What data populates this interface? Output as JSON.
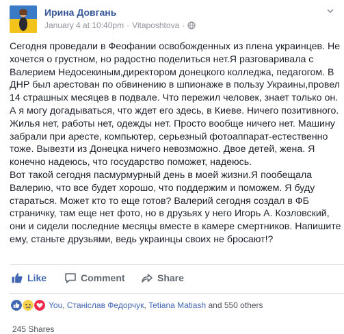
{
  "post": {
    "author": "Ирина Довгань",
    "timestamp": "January 4 at 10:40pm",
    "separator": "·",
    "location": "Vitaposhtova",
    "icons": {
      "privacy": "globe-icon",
      "menu": "chevron-down-icon"
    },
    "body": [
      "Сегодня проведали в Феофании освобожденных из плена украинцев. Не хочется о грустном, но радостно поделиться нет.Я разговаривала с Валерием Недосекиным,директором донецкого колледжа, педагогом. В ДНР был арестован по обвинению в шпионаже в пользу Украины,провел 14 страшных месяцев в подвале. Что пережил человек, знает только он. А я могу догадываться, что ждет его здесь, в Киеве. Ничего позитивного. Жилья нет, работы нет, одежды нет. Просто вообще ничего нет. Машину забрали при аресте, компьютер, серьезный фотоаппарат-естественно тоже. Вывезти из Донецка ничего невозможно. Двое детей, жена. Я конечно надеюсь, что государство поможет, надеюсь.",
      "Вот такой сегодня пасмурмурный день в моей жизни.Я пообещала Валерию, что все будет хорошо, что поддержим и поможем. Я буду стараться. Может кто то еще готов? Валерий сегодня создал в ФБ страничку, там еще нет фото, но в друзьях у него Игорь А. Козловский, они и сидели последние месяцы вместе в камере смертников. Напишите ему, станьте друзьями, ведь украинцы своих не бросают!?"
    ]
  },
  "actions": {
    "like": "Like",
    "comment": "Comment",
    "share": "Share"
  },
  "reactions": {
    "types": [
      "like-reaction-icon",
      "sad-reaction-icon",
      "love-reaction-icon"
    ],
    "you": "You",
    "sep1": ", ",
    "name1": "Станіслав Федорчук",
    "sep2": ", ",
    "name2": "Tetiana Matiash",
    "rest": " and 550 others"
  },
  "shares": "245 Shares",
  "colors": {
    "link": "#365899",
    "accent": "#4267b2",
    "meta": "#90949c",
    "text": "#1d2129"
  }
}
